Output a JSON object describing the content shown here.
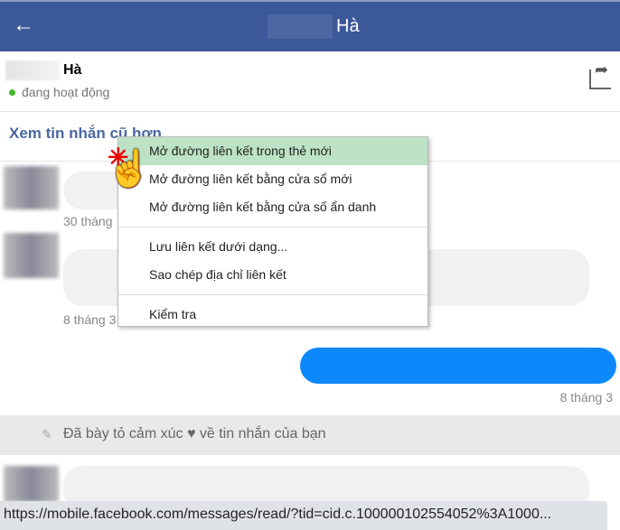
{
  "header": {
    "title": "Hà",
    "back_icon": "arrow-left-icon"
  },
  "profile": {
    "name": "Hà",
    "status": "đang hoạt động"
  },
  "older_link": "Xem tin nhắn cũ hơn",
  "messages": {
    "ts1": "30 tháng",
    "ts2": "8 tháng 3",
    "ts3": "8 tháng 3"
  },
  "reaction": "Đã bày tỏ cảm xúc ♥ về tin nhắn của bạn",
  "context_menu": {
    "items": [
      "Mở đường liên kết trong thẻ mới",
      "Mở đường liên kết bằng cửa sổ mới",
      "Mở đường liên kết bằng cửa số ẩn danh",
      "Lưu liên kết dưới dạng...",
      "Sao chép địa chỉ liên kết",
      "Kiểm tra"
    ]
  },
  "status_url": "https://mobile.facebook.com/messages/read/?tid=cid.c.100000102554052%3A1000...",
  "colors": {
    "header": "#3b5998",
    "outgoing": "#0d88fb",
    "highlight": "#bce3c5"
  }
}
